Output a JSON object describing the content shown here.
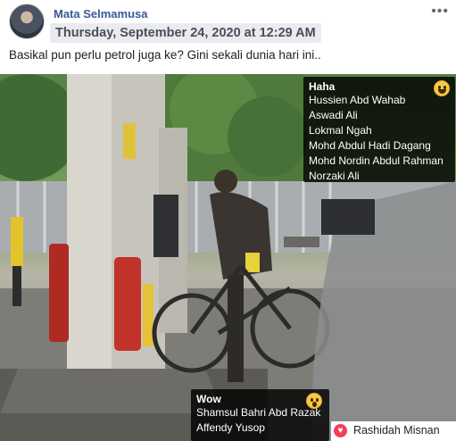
{
  "post": {
    "author": "Mata Selmamusa",
    "timestamp": "Thursday, September 24, 2020 at 12:29 AM",
    "caption": "Basikal pun perlu petrol juga ke? Gini sekali dunia hari ini..",
    "more_icon": "more-options-icon"
  },
  "reactions": {
    "haha": {
      "title": "Haha",
      "icon": "haha-emoji-icon",
      "names": [
        "Hussien Abd Wahab",
        "Aswadi Ali",
        "Lokmal Ngah",
        "Mohd Abdul Hadi Dagang",
        "Mohd Nordin Abdul Rahman",
        "Norzaki Ali"
      ]
    },
    "wow": {
      "title": "Wow",
      "icon": "wow-emoji-icon",
      "names": [
        "Shamsul Bahri Abd Razak",
        "Affendy Yusop"
      ]
    },
    "love": {
      "icon": "love-heart-icon",
      "name": "Rashidah Misnan"
    }
  },
  "colors": {
    "author_link": "#385898",
    "tooltip_bg": "#000000",
    "love": "#f33e58",
    "emoji_yellow": "#f7c948"
  }
}
